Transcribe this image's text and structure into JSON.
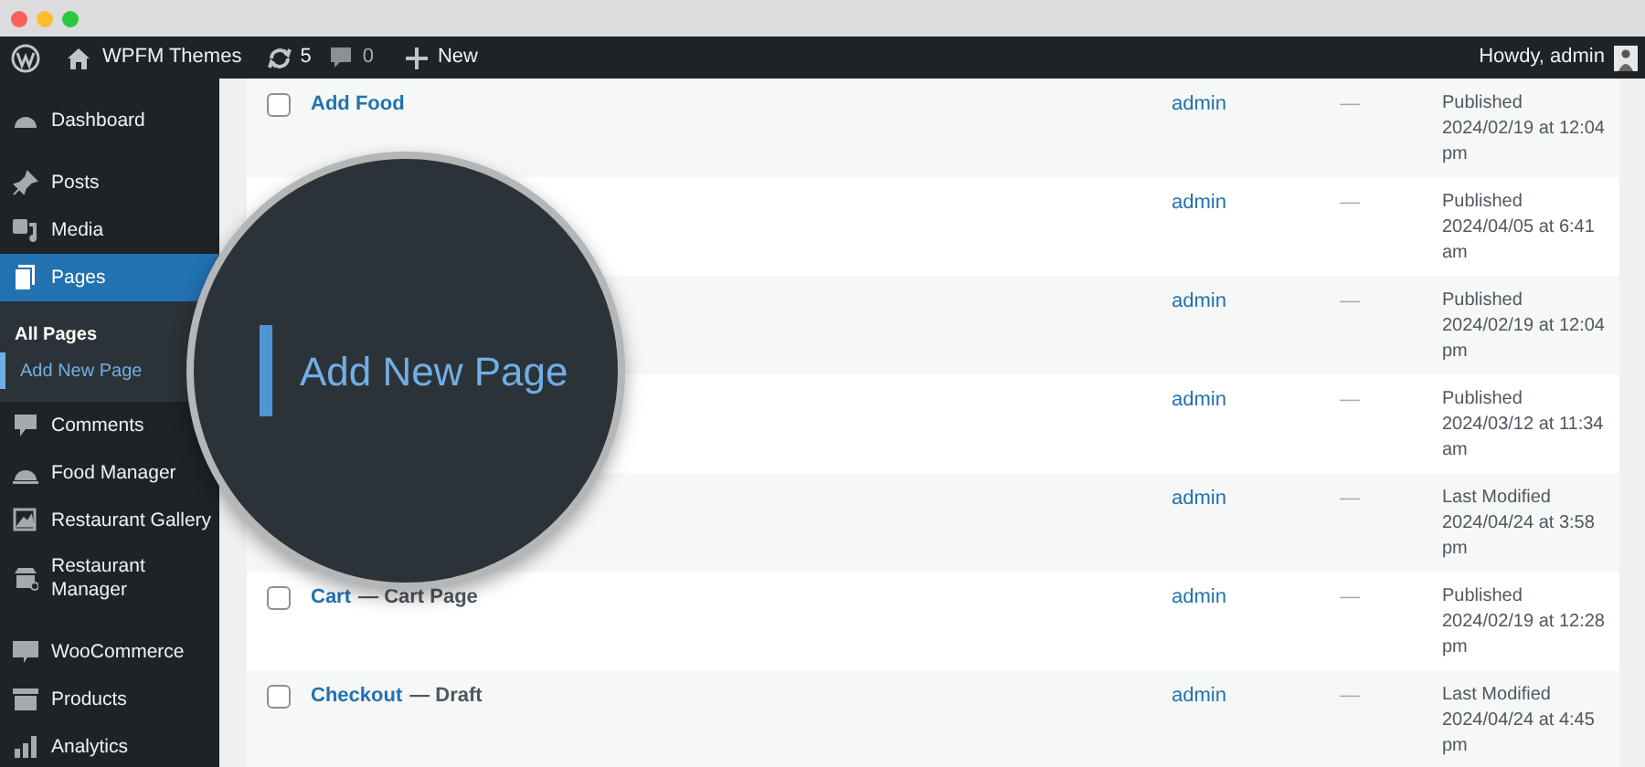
{
  "admin_bar": {
    "site": "WPFM Themes",
    "updates": "5",
    "comments": "0",
    "new": "New",
    "greeting": "Howdy, admin"
  },
  "sidebar": {
    "groups": [
      [
        {
          "label": "Dashboard",
          "selected": false
        }
      ],
      [
        {
          "label": "Posts",
          "selected": false
        },
        {
          "label": "Media",
          "selected": false
        },
        {
          "label": "Pages",
          "selected": true,
          "children": [
            {
              "label": "All Pages",
              "current": true,
              "highlighted": false
            },
            {
              "label": "Add New Page",
              "current": false,
              "highlighted": true
            }
          ]
        },
        {
          "label": "Comments",
          "selected": false
        },
        {
          "label": "Food Manager",
          "selected": false
        },
        {
          "label": "Restaurant Gallery",
          "selected": false
        },
        {
          "label": "Restaurant Manager",
          "selected": false
        }
      ],
      [
        {
          "label": "WooCommerce",
          "selected": false
        },
        {
          "label": "Products",
          "selected": false
        },
        {
          "label": "Analytics",
          "selected": false
        }
      ]
    ]
  },
  "rows": [
    {
      "title": "Add Food",
      "checked": false,
      "author": "admin",
      "comments": "—",
      "status": "Published",
      "date": "2024/02/19 at 12:04 pm"
    },
    {
      "author": "admin",
      "comments": "—",
      "status": "Published",
      "date": "2024/04/05 at 6:41 am"
    },
    {
      "author": "admin",
      "comments": "—",
      "status": "Published",
      "date": "2024/02/19 at 12:04 pm"
    },
    {
      "author": "admin",
      "comments": "—",
      "status": "Published",
      "date": "2024/03/12 at 11:34 am"
    },
    {
      "author": "admin",
      "comments": "—",
      "status": "Last Modified",
      "date": "2024/04/24 at 3:58 pm"
    },
    {
      "title": "Cart",
      "state": "— Cart Page",
      "checked": false,
      "author": "admin",
      "comments": "—",
      "status": "Published",
      "date": "2024/02/19 at 12:28 pm"
    },
    {
      "title": "Checkout",
      "state": "— Draft",
      "checked": false,
      "author": "admin",
      "comments": "—",
      "status": "Last Modified",
      "date": "2024/04/24 at 4:45 pm"
    }
  ],
  "magnifier": {
    "text": "Add New Page"
  }
}
